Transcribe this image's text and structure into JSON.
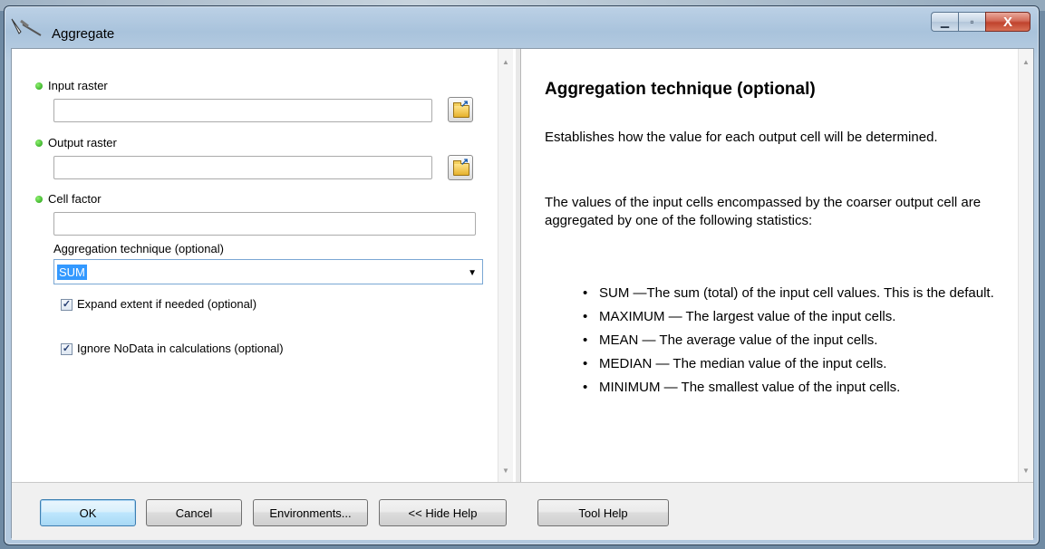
{
  "window": {
    "title": "Aggregate",
    "buttons": {
      "minimize": "▁",
      "maximize": "▫",
      "close": "X"
    }
  },
  "form": {
    "input_raster_label": "Input raster",
    "output_raster_label": "Output raster",
    "cell_factor_label": "Cell factor",
    "aggregation_label": "Aggregation technique (optional)",
    "aggregation_value": "SUM",
    "expand_extent_label": "Expand extent if needed (optional)",
    "expand_extent_checked": true,
    "ignore_nodata_label": "Ignore NoData in calculations (optional)",
    "ignore_nodata_checked": true
  },
  "help": {
    "title": "Aggregation technique (optional)",
    "para1": "Establishes how the value for each output cell will be determined.",
    "para2": "The values of the input cells encompassed by the coarser output cell are aggregated by one of the following statistics:",
    "items": [
      "SUM —The sum (total) of the input cell values. This is the default.",
      "MAXIMUM — The largest value of the input cells.",
      "MEAN — The average value of the input cells.",
      "MEDIAN — The median value of the input cells.",
      "MINIMUM — The smallest value of the input cells."
    ]
  },
  "buttons": {
    "ok": "OK",
    "cancel": "Cancel",
    "environments": "Environments...",
    "hide_help": "<< Hide Help",
    "tool_help": "Tool Help"
  },
  "colors": {
    "required_dot": "#1f9a13",
    "selection": "#3399ff",
    "close_button": "#c0432d"
  }
}
